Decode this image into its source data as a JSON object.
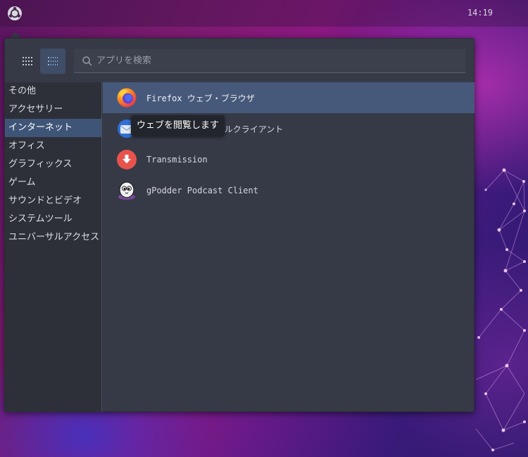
{
  "top_panel": {
    "clock": "14:19"
  },
  "menu": {
    "search": {
      "placeholder": "アプリを検索",
      "value": ""
    },
    "categories": [
      {
        "label": "その他",
        "active": false
      },
      {
        "label": "アクセサリー",
        "active": false
      },
      {
        "label": "インターネット",
        "active": true
      },
      {
        "label": "オフィス",
        "active": false
      },
      {
        "label": "グラフィックス",
        "active": false
      },
      {
        "label": "ゲーム",
        "active": false
      },
      {
        "label": "サウンドとビデオ",
        "active": false
      },
      {
        "label": "システムツール",
        "active": false
      },
      {
        "label": "ユニバーサルアクセス",
        "active": false
      }
    ],
    "apps": [
      {
        "label": "Firefox ウェブ・ブラウザ",
        "icon": "firefox-icon",
        "active": true
      },
      {
        "label": "Thunderbird メールクライアント",
        "icon": "thunderbird-icon",
        "active": false
      },
      {
        "label": "Transmission",
        "icon": "transmission-icon",
        "active": false
      },
      {
        "label": "gPodder Podcast Client",
        "icon": "gpodder-icon",
        "active": false
      }
    ],
    "tooltip": "ウェブを閲覧します"
  },
  "colors": {
    "menu_bg": "#363a47",
    "sidebar_bg": "#2d3039",
    "selection": "#3f5578",
    "accent_blue": "#5b8fd6"
  }
}
